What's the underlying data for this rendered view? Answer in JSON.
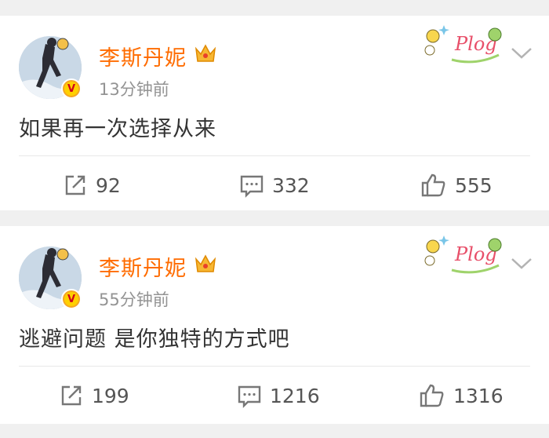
{
  "posts": [
    {
      "username": "李斯丹妮",
      "time": "13分钟前",
      "content": "如果再一次选择从来",
      "sticker_text": "Plog",
      "reposts": "92",
      "comments": "332",
      "likes": "555",
      "verified_badge": "V"
    },
    {
      "username": "李斯丹妮",
      "time": "55分钟前",
      "content": "逃避问题 是你独特的方式吧",
      "sticker_text": "Plog",
      "reposts": "199",
      "comments": "1216",
      "likes": "1316",
      "verified_badge": "V"
    }
  ],
  "icons": {
    "repost": "repost-icon",
    "comment": "comment-icon",
    "like": "thumbs-up-icon",
    "more": "chevron-down-icon",
    "vip": "crown-icon"
  },
  "colors": {
    "username": "#ff6c00",
    "timestamp": "#939393",
    "text": "#333333",
    "background": "#f0f0f0"
  }
}
